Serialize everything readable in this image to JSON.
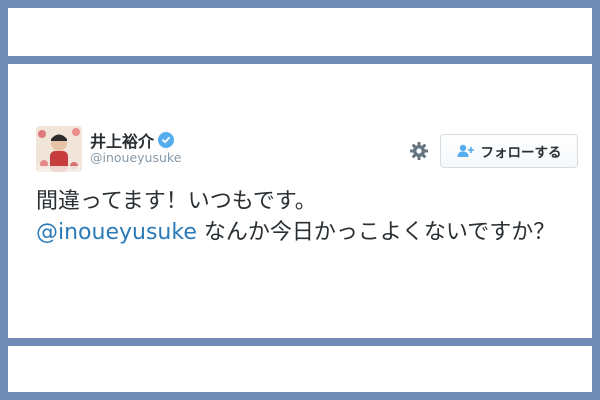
{
  "profile": {
    "display_name": "井上裕介",
    "handle": "@inoueyusuke",
    "verified": true,
    "avatar_icon": "profile-photo"
  },
  "actions": {
    "settings_icon": "gear-icon",
    "follow_icon": "add-user-icon",
    "follow_label": "フォローする"
  },
  "tweet": {
    "line1": "間違ってます！いつもです。",
    "mention": "@inoueyusuke",
    "line2_rest": " なんか今日かっこよくないですか？"
  },
  "colors": {
    "frame": "#6f8bb6",
    "mention": "#2b7bb9",
    "verified": "#55acee",
    "handle": "#8899a6",
    "text": "#292f33"
  }
}
